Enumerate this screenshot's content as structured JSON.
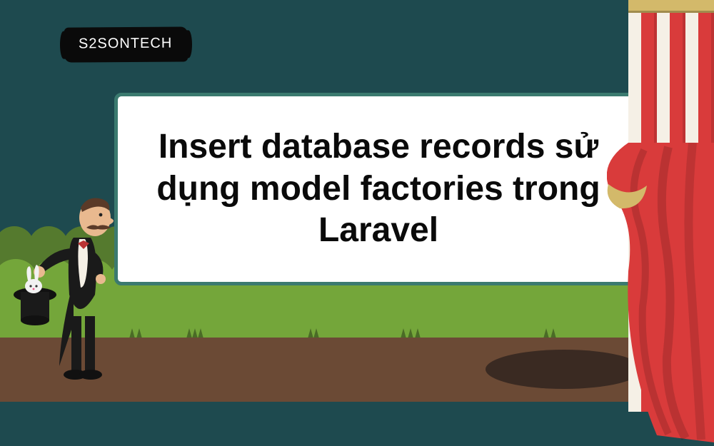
{
  "logo": {
    "text": "S2SONTECH"
  },
  "card": {
    "title": "Insert database records sử dụng model factories trong Laravel"
  },
  "colors": {
    "sky": "#1e4a4f",
    "bush_back": "#557a2e",
    "bush_front": "#74a63a",
    "ground": "#6b4a35",
    "curtain_red": "#d93b3b",
    "curtain_white": "#f5f0e6",
    "curtain_rod": "#d3b96a",
    "card_border": "#3b7a6f"
  },
  "icons": {
    "magician": "magician-with-hat-and-rabbit-icon",
    "curtain": "theater-curtain-icon"
  }
}
